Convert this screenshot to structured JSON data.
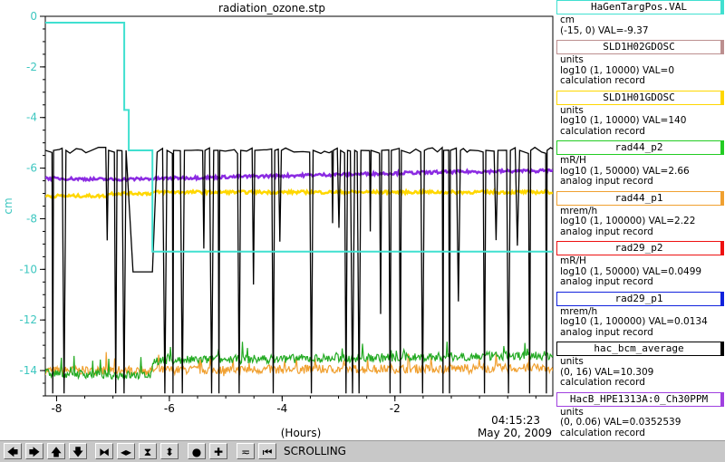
{
  "chart_data": {
    "type": "line",
    "title": "radiation_ozone.stp",
    "xlabel": "(Hours)",
    "ylabel": "cm",
    "xlim": [
      -8.2,
      0.8
    ],
    "ylim": [
      -15,
      0
    ],
    "x_ticks": [
      "-8",
      "-6",
      "-4",
      "-2"
    ],
    "x_tick_values": [
      -8,
      -6,
      -4,
      -2
    ],
    "y_ticks": [
      "0",
      "-2",
      "-4",
      "-6",
      "-8",
      "-10",
      "-12",
      "-14"
    ],
    "y_tick_values": [
      0,
      -2,
      -4,
      -6,
      -8,
      -10,
      -12,
      -14
    ],
    "timestamp_time": "04:15:23",
    "timestamp_date": "May 20, 2009",
    "series": [
      {
        "name": "HaGenTargPos.VAL",
        "color": "#40e0d0",
        "kind": "step",
        "x": [
          -8.2,
          -6.8,
          -6.8,
          -6.72,
          -6.72,
          -6.3,
          -6.3,
          0.8
        ],
        "y": [
          -0.25,
          -0.25,
          -3.7,
          -3.7,
          -5.3,
          -5.3,
          -9.3,
          -9.3
        ]
      },
      {
        "name": "rad44_p2",
        "color": "#8b2be2",
        "kind": "line",
        "x": [
          -8.2,
          -7,
          -6,
          -5,
          -4,
          -3,
          -2,
          -1,
          0.8
        ],
        "y": [
          -6.4,
          -6.45,
          -6.4,
          -6.35,
          -6.3,
          -6.25,
          -6.2,
          -6.15,
          -6.1
        ]
      },
      {
        "name": "rad44_p1",
        "color": "#ffd700",
        "kind": "line",
        "x": [
          -8.2,
          -7.1,
          -7.1,
          -6.3,
          -6.3,
          0.8
        ],
        "y": [
          -7.1,
          -7.1,
          -7.0,
          -7.0,
          -6.95,
          -6.95
        ]
      },
      {
        "name": "hac_bcm_average",
        "color": "#000000",
        "kind": "black",
        "x": [
          -8.2,
          -6.3,
          -6.3,
          0.8
        ],
        "y": [
          -5.3,
          -5.3,
          -5.3,
          -5.3
        ]
      },
      {
        "name": "rad29_p2",
        "color": "#22aa22",
        "kind": "noise",
        "x": [
          -8.2,
          -6.3,
          -6.3,
          0.8
        ],
        "y": [
          -14.1,
          -14.2,
          -13.6,
          -13.4
        ]
      },
      {
        "name": "rad29_p1",
        "color": "#f0a030",
        "kind": "noise",
        "x": [
          -8.2,
          0.8
        ],
        "y": [
          -14.0,
          -13.9
        ]
      }
    ]
  },
  "legend": [
    {
      "name": "HaGenTargPos.VAL",
      "color": "#40e0d0",
      "lines": [
        "cm",
        "(-15, 0) VAL=-9.37"
      ]
    },
    {
      "name": "SLD1H02GDOSC",
      "color": "#bc8f8f",
      "lines": [
        "units",
        "log10 (1, 10000) VAL=0",
        "calculation record"
      ]
    },
    {
      "name": "SLD1H01GDOSC",
      "color": "#ffd700",
      "lines": [
        "units",
        "log10 (1, 10000) VAL=140",
        "calculation record"
      ]
    },
    {
      "name": "rad44_p2",
      "color": "#22cc22",
      "lines": [
        "mR/H",
        "log10 (1, 50000) VAL=2.66",
        "analog input record"
      ]
    },
    {
      "name": "rad44_p1",
      "color": "#f0a030",
      "lines": [
        "mrem/h",
        "log10 (1, 100000) VAL=2.22",
        "analog input record"
      ]
    },
    {
      "name": "rad29_p2",
      "color": "#ee1111",
      "lines": [
        "mR/H",
        "log10 (1, 50000) VAL=0.0499",
        "analog input record"
      ]
    },
    {
      "name": "rad29_p1",
      "color": "#1122dd",
      "lines": [
        "mrem/h",
        "log10 (1, 100000) VAL=0.0134",
        "analog input record"
      ]
    },
    {
      "name": "hac_bcm_average",
      "color": "#000000",
      "lines": [
        "units",
        "(0, 16) VAL=10.309",
        "calculation record"
      ]
    },
    {
      "name": "HacB_HPE1313A:0_Ch30PPM",
      "color": "#a040e0",
      "lines": [
        "units",
        "(0, 0.06) VAL=0.0352539",
        "calculation record"
      ]
    }
  ],
  "toolbar": {
    "buttons": [
      {
        "icon": "arrow-left-icon",
        "glyph": "🡄"
      },
      {
        "icon": "arrow-right-icon",
        "glyph": "🡆"
      },
      {
        "icon": "arrow-up-icon",
        "glyph": "🡅"
      },
      {
        "icon": "arrow-down-icon",
        "glyph": "🡇"
      },
      {
        "icon": "zoom-in-horizontal-icon",
        "glyph": "⧓"
      },
      {
        "icon": "zoom-out-horizontal-icon",
        "glyph": "◂▸"
      },
      {
        "icon": "zoom-in-vertical-icon",
        "glyph": "⧗"
      },
      {
        "icon": "zoom-out-vertical-icon",
        "glyph": "⬍"
      },
      {
        "icon": "stop-icon",
        "glyph": "●"
      },
      {
        "icon": "add-icon",
        "glyph": "✚"
      },
      {
        "icon": "autoscale-icon",
        "glyph": "≂"
      },
      {
        "icon": "first-page-icon",
        "glyph": "⏮"
      }
    ],
    "mode": "SCROLLING"
  }
}
